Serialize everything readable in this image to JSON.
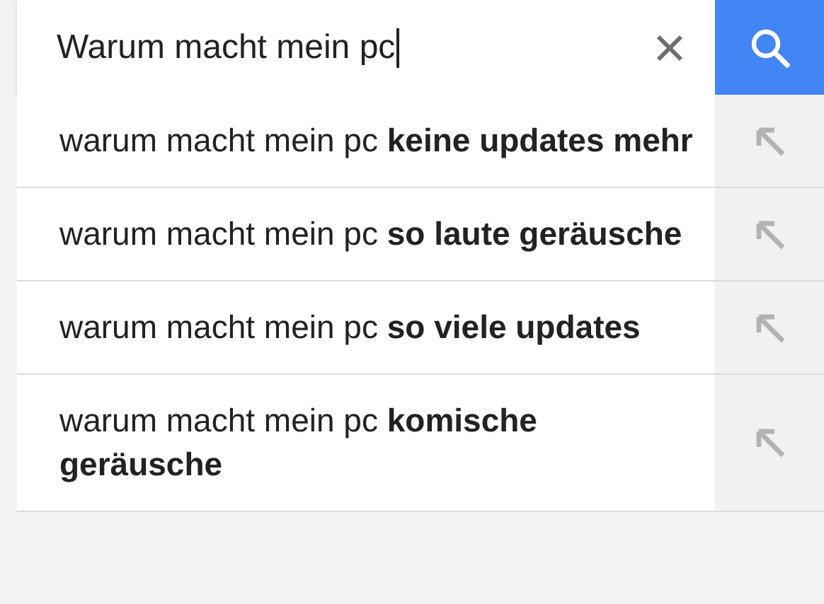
{
  "search": {
    "value": "Warum macht mein pc",
    "focused": true
  },
  "suggestions": [
    {
      "text": "warum macht mein pc **keine updates mehr**"
    },
    {
      "text": "warum macht mein pc **so laute geräusche**"
    },
    {
      "text": "warum macht mein pc **so viele updates**"
    },
    {
      "text": "warum macht mein pc **komische geräusche**"
    }
  ]
}
